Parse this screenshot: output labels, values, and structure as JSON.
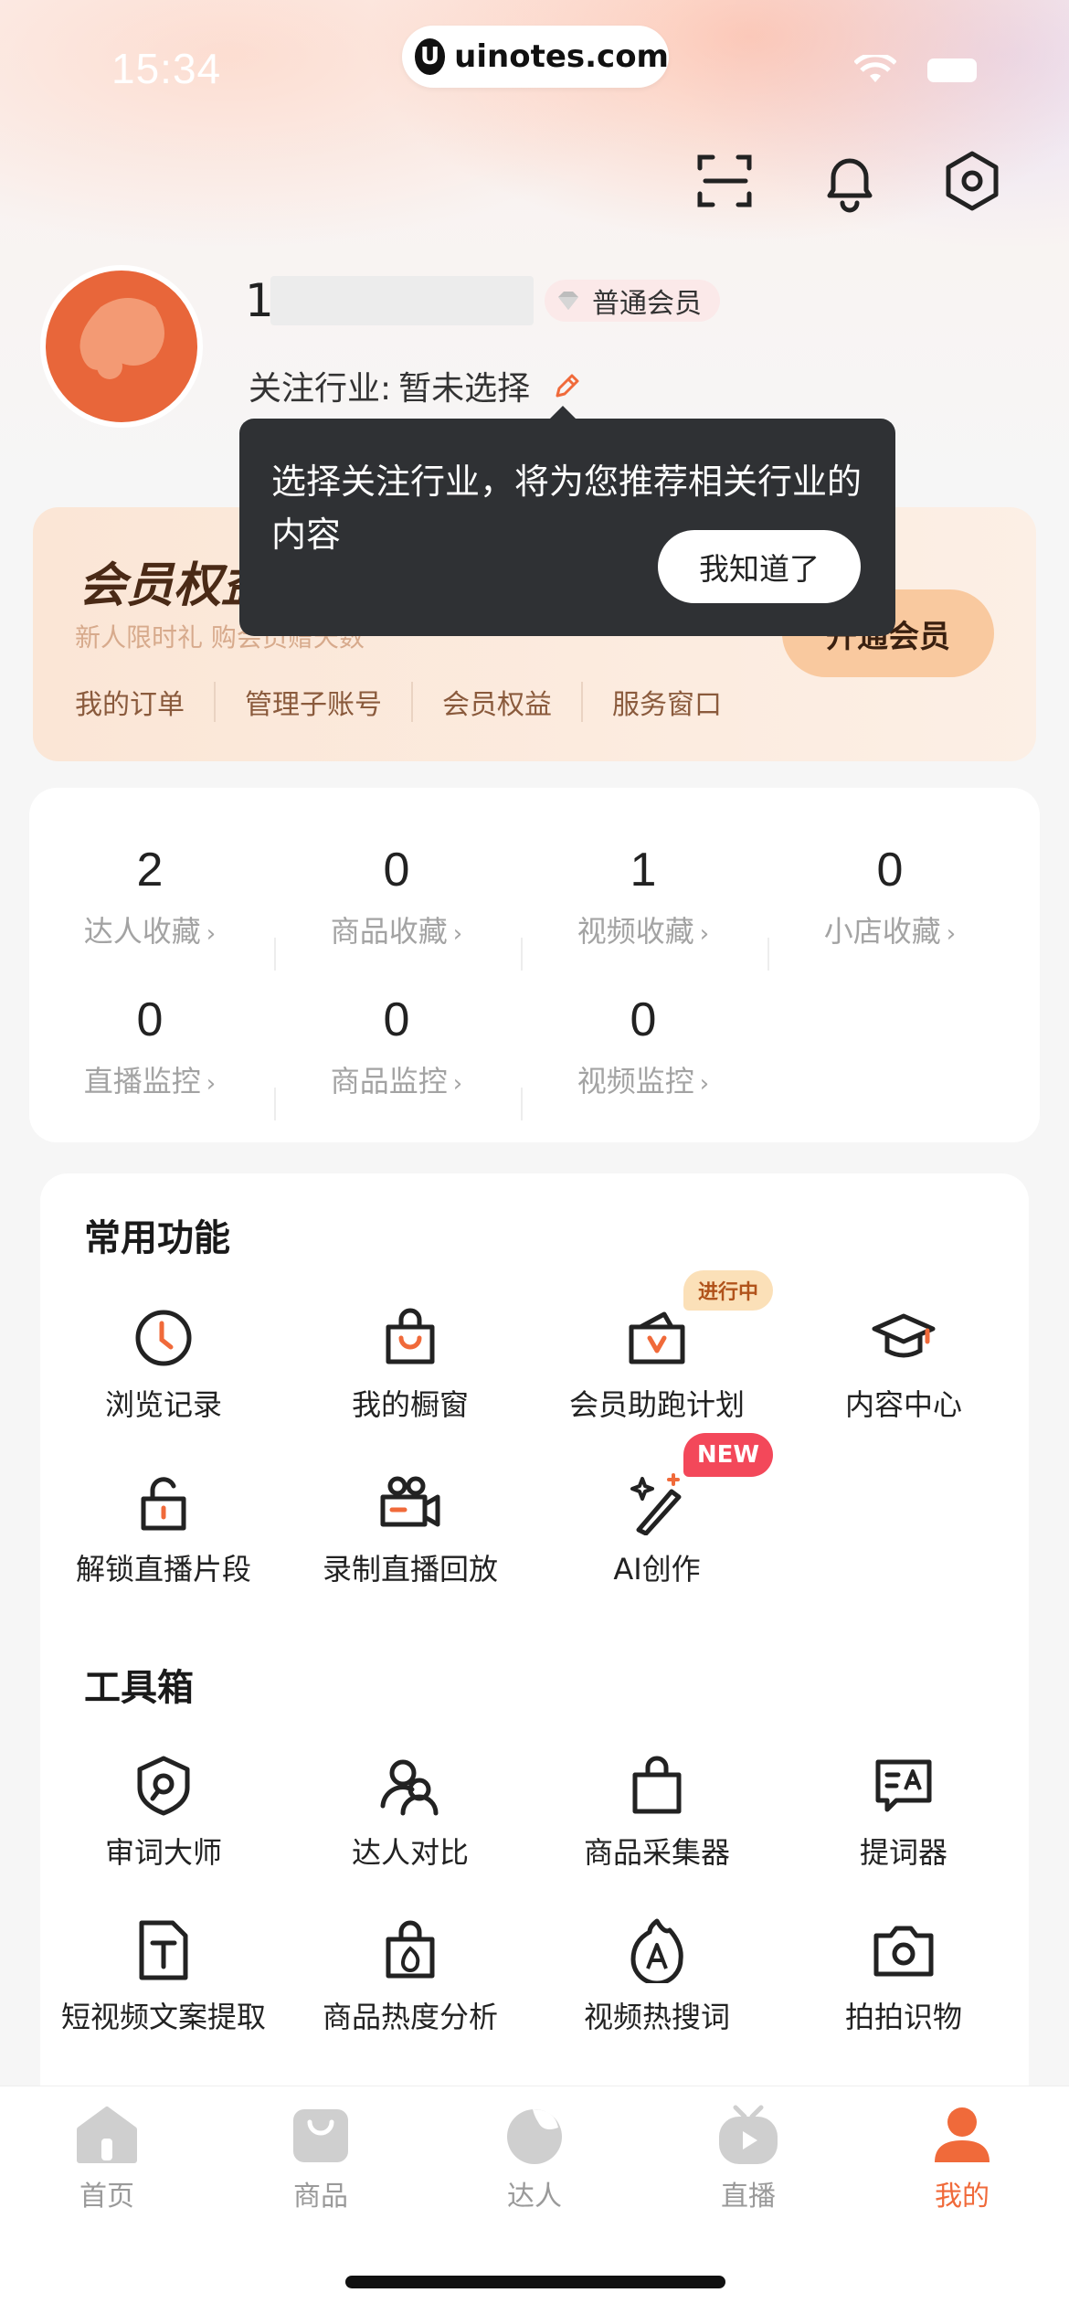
{
  "status": {
    "time": "15:34",
    "url": "uinotes.com",
    "url_logo": "U"
  },
  "profile": {
    "username": "1",
    "member_level": "普通会员",
    "industry_label": "关注行业:",
    "industry_value": "暂未选择"
  },
  "tooltip": {
    "text": "选择关注行业，将为您推荐相关行业的内容",
    "button": "我知道了"
  },
  "vip": {
    "title": "会员权益中心",
    "subtitle": "新人限时礼 购会员赠天数",
    "open_button": "开通会员",
    "links": [
      "我的订单",
      "管理子账号",
      "会员权益",
      "服务窗口"
    ]
  },
  "stats": [
    {
      "value": "2",
      "label": "达人收藏"
    },
    {
      "value": "0",
      "label": "商品收藏"
    },
    {
      "value": "1",
      "label": "视频收藏"
    },
    {
      "value": "0",
      "label": "小店收藏"
    },
    {
      "value": "0",
      "label": "直播监控"
    },
    {
      "value": "0",
      "label": "商品监控"
    },
    {
      "value": "0",
      "label": "视频监控"
    }
  ],
  "common": {
    "title": "常用功能",
    "items": [
      {
        "label": "浏览记录",
        "icon": "clock-icon"
      },
      {
        "label": "我的橱窗",
        "icon": "shopping-bag-icon"
      },
      {
        "label": "会员助跑计划",
        "icon": "vip-box-icon",
        "tag": "进行中"
      },
      {
        "label": "内容中心",
        "icon": "graduation-cap-icon"
      },
      {
        "label": "解锁直播片段",
        "icon": "unlock-icon"
      },
      {
        "label": "录制直播回放",
        "icon": "video-camera-icon"
      },
      {
        "label": "AI创作",
        "icon": "magic-wand-icon",
        "tag": "NEW"
      }
    ]
  },
  "toolbox": {
    "title": "工具箱",
    "items": [
      {
        "label": "审词大师",
        "icon": "shield-search-icon"
      },
      {
        "label": "达人对比",
        "icon": "users-icon"
      },
      {
        "label": "商品采集器",
        "icon": "bag-icon"
      },
      {
        "label": "提词器",
        "icon": "teleprompter-icon"
      },
      {
        "label": "短视频文案提取",
        "icon": "text-document-icon"
      },
      {
        "label": "商品热度分析",
        "icon": "hot-bag-icon"
      },
      {
        "label": "视频热搜词",
        "icon": "flame-a-icon"
      },
      {
        "label": "拍拍识物",
        "icon": "camera-icon"
      }
    ]
  },
  "tabs": [
    {
      "label": "首页",
      "icon": "home-icon"
    },
    {
      "label": "商品",
      "icon": "product-icon"
    },
    {
      "label": "达人",
      "icon": "talent-icon"
    },
    {
      "label": "直播",
      "icon": "live-tv-icon"
    },
    {
      "label": "我的",
      "icon": "me-icon",
      "active": true
    }
  ],
  "colors": {
    "accent": "#f06a3a",
    "vip_text": "#4a2a16",
    "tooltip_bg": "#2f3134"
  }
}
